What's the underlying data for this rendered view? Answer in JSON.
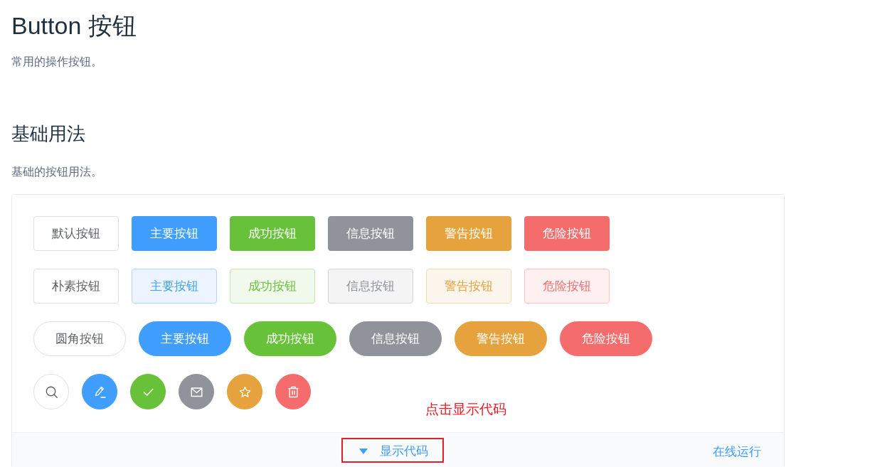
{
  "page": {
    "title": "Button 按钮",
    "description": "常用的操作按钮。"
  },
  "section": {
    "title": "基础用法",
    "description": "基础的按钮用法。"
  },
  "demo": {
    "rows": [
      {
        "kind": "solid",
        "buttons": [
          {
            "kind": "default",
            "label": "默认按钮"
          },
          {
            "kind": "primary",
            "label": "主要按钮"
          },
          {
            "kind": "success",
            "label": "成功按钮"
          },
          {
            "kind": "info",
            "label": "信息按钮"
          },
          {
            "kind": "warning",
            "label": "警告按钮"
          },
          {
            "kind": "danger",
            "label": "危险按钮"
          }
        ]
      },
      {
        "kind": "plain",
        "buttons": [
          {
            "kind": "default",
            "label": "朴素按钮"
          },
          {
            "kind": "primary",
            "label": "主要按钮"
          },
          {
            "kind": "success",
            "label": "成功按钮"
          },
          {
            "kind": "info",
            "label": "信息按钮"
          },
          {
            "kind": "warning",
            "label": "警告按钮"
          },
          {
            "kind": "danger",
            "label": "危险按钮"
          }
        ]
      },
      {
        "kind": "round",
        "buttons": [
          {
            "kind": "default",
            "label": "圆角按钮"
          },
          {
            "kind": "primary",
            "label": "主要按钮"
          },
          {
            "kind": "success",
            "label": "成功按钮"
          },
          {
            "kind": "info",
            "label": "信息按钮"
          },
          {
            "kind": "warning",
            "label": "警告按钮"
          },
          {
            "kind": "danger",
            "label": "危险按钮"
          }
        ]
      },
      {
        "kind": "circle",
        "buttons": [
          {
            "kind": "default"
          },
          {
            "kind": "primary"
          },
          {
            "kind": "success"
          },
          {
            "kind": "info"
          },
          {
            "kind": "warning"
          },
          {
            "kind": "danger"
          }
        ]
      }
    ],
    "annotation": {
      "text": "点击显示代码"
    },
    "controls": {
      "toggle": {
        "label": "显示代码",
        "expanded": false,
        "highlighted": true
      },
      "run_link": "在线运行"
    }
  }
}
